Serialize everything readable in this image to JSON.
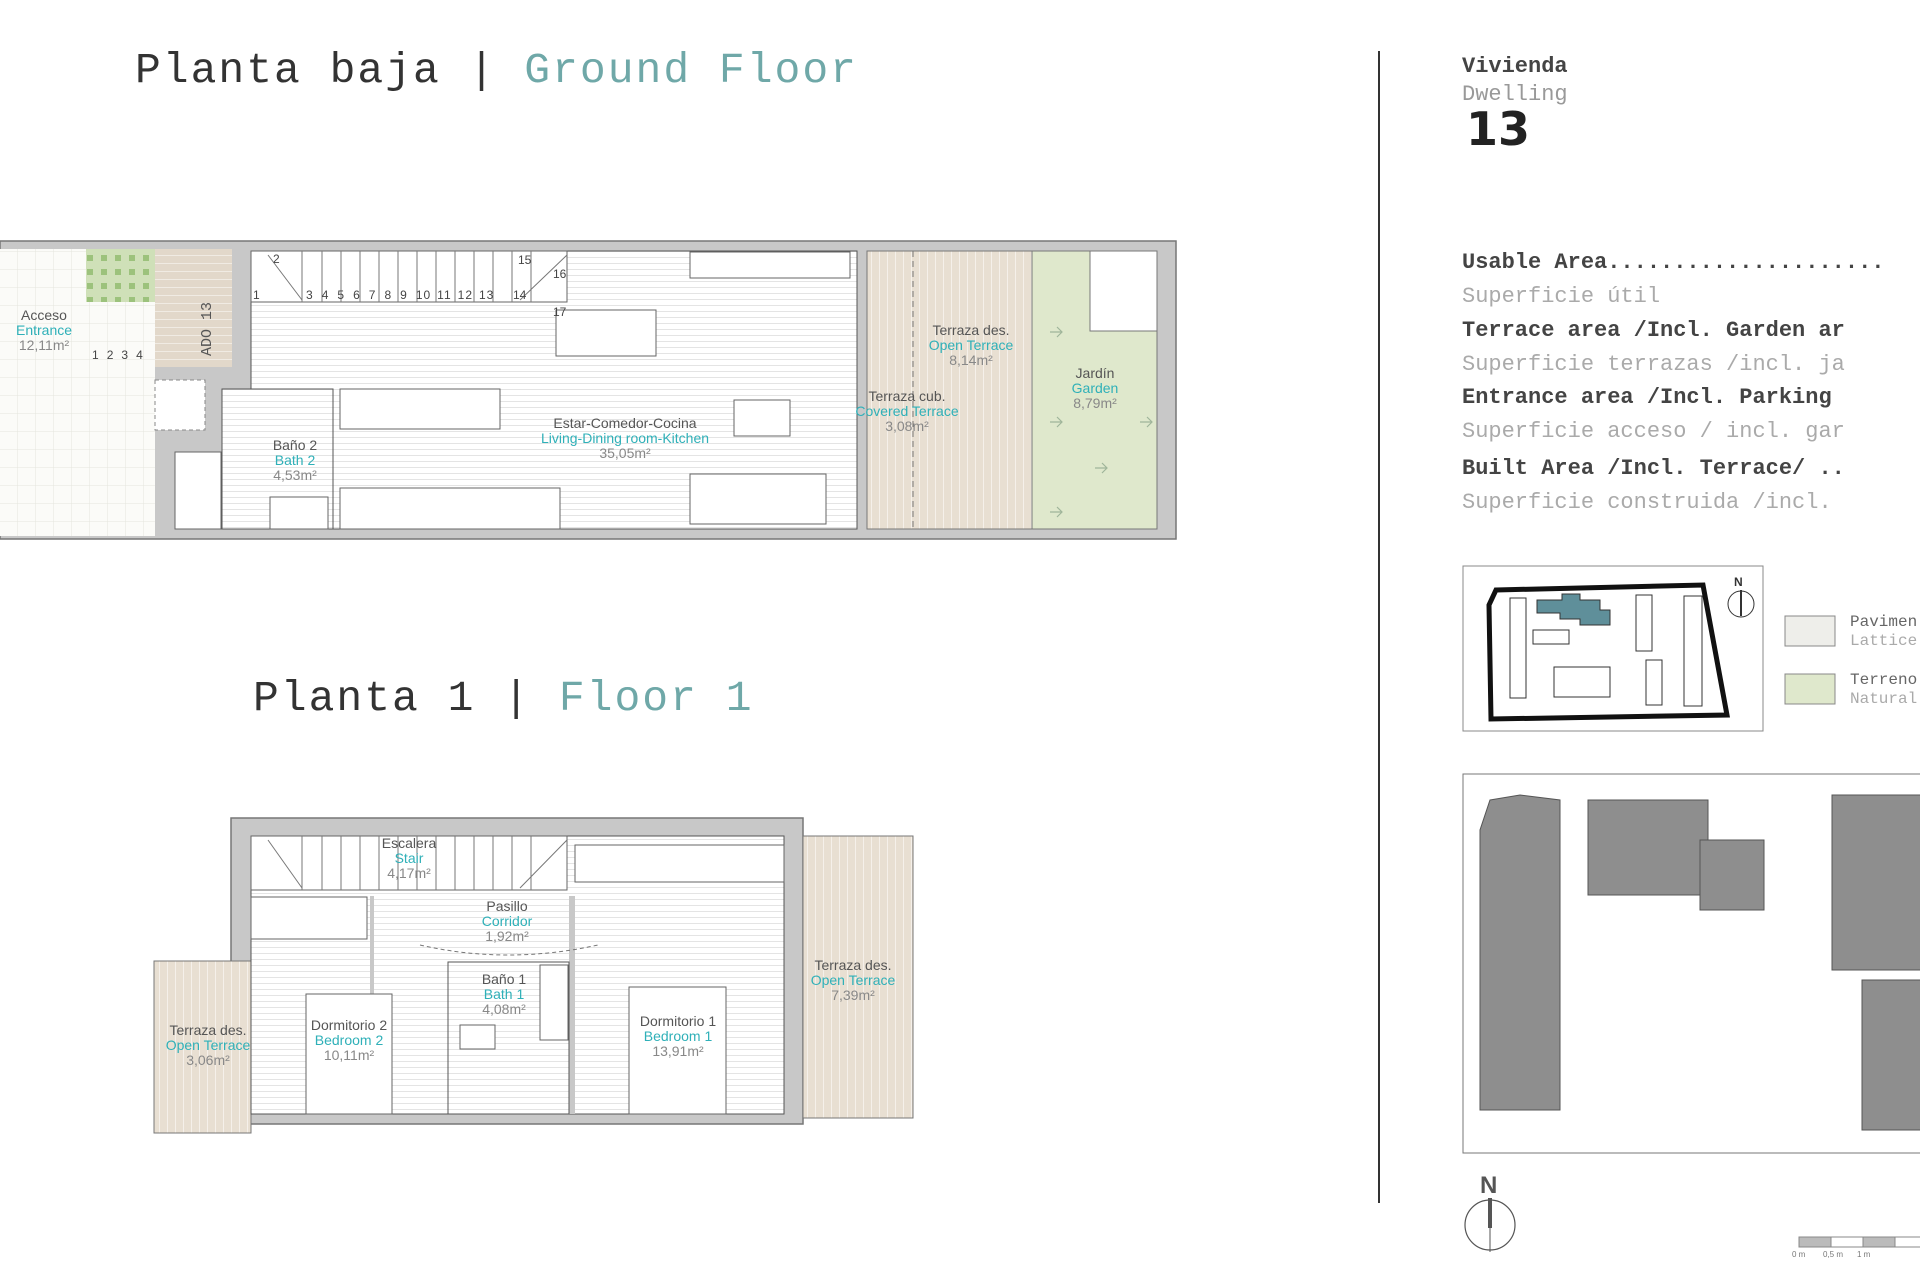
{
  "ground_floor": {
    "title_es": "Planta baja",
    "separator": "|",
    "title_en": "Ground Floor",
    "entrance_tag": "ADO 13",
    "stair_numbers": [
      "1",
      "2",
      "3",
      "4",
      "5",
      "6",
      "7",
      "8",
      "9",
      "10",
      "11",
      "12",
      "13",
      "14",
      "15",
      "16",
      "17"
    ],
    "entrance_steps": [
      "1",
      "2",
      "3",
      "4"
    ],
    "rooms": [
      {
        "es": "Acceso",
        "en": "Entrance",
        "area": "12,11m²"
      },
      {
        "es": "Baño 2",
        "en": "Bath 2",
        "area": "4,53m²"
      },
      {
        "es": "Estar-Comedor-Cocina",
        "en": "Living-Dining room-Kitchen",
        "area": "35,05m²"
      },
      {
        "es": "Terraza des.",
        "en": "Open Terrace",
        "area": "8,14m²"
      },
      {
        "es": "Terraza cub.",
        "en": "Covered Terrace",
        "area": "3,08m²"
      },
      {
        "es": "Jardín",
        "en": "Garden",
        "area": "8,79m²"
      }
    ]
  },
  "floor_1": {
    "title_es": "Planta 1",
    "separator": "|",
    "title_en": "Floor 1",
    "rooms": [
      {
        "es": "Escalera",
        "en": "Stair",
        "area": "4,17m²"
      },
      {
        "es": "Pasillo",
        "en": "Corridor",
        "area": "1,92m²"
      },
      {
        "es": "Baño 1",
        "en": "Bath 1",
        "area": "4,08m²"
      },
      {
        "es": "Dormitorio 2",
        "en": "Bedroom 2",
        "area": "10,11m²"
      },
      {
        "es": "Dormitorio 1",
        "en": "Bedroom 1",
        "area": "13,91m²"
      },
      {
        "es": "Terraza des.",
        "en": "Open Terrace",
        "area": "3,06m²"
      },
      {
        "es": "Terraza des.",
        "en": "Open Terrace",
        "area": "7,39m²"
      }
    ]
  },
  "dwelling": {
    "label_es": "Vivienda",
    "label_en": "Dwelling",
    "number": "13"
  },
  "areas": [
    {
      "en": "Usable Area.....................",
      "es": "Superficie útil"
    },
    {
      "en": "Terrace area /Incl. Garden ar",
      "es": "Superficie terrazas /incl. ja"
    },
    {
      "en": "Entrance area /Incl. Parking",
      "es": "Superficie acceso / incl. gar"
    },
    {
      "en": "Built Area /Incl. Terrace/ ..",
      "es": "Superficie construida /incl."
    }
  ],
  "legend": [
    {
      "es": "Pavimen",
      "en": "Lattice",
      "swatch": "#e6e6e0"
    },
    {
      "es": "Terreno",
      "en": "Natural",
      "swatch": "#dfe8cc"
    }
  ],
  "north_label": "N",
  "scale_bar": [
    "0 m",
    "0,5 m",
    "1 m"
  ],
  "colors": {
    "accent_teal": "#2fb0b8",
    "title_teal": "#6fa8a8",
    "wall": "#c8c8c8",
    "wood": "#e6ddd0",
    "garden": "#dfe8cc",
    "site_buildings": "#8a8a8a",
    "highlight_block": "#5f8f9a"
  }
}
